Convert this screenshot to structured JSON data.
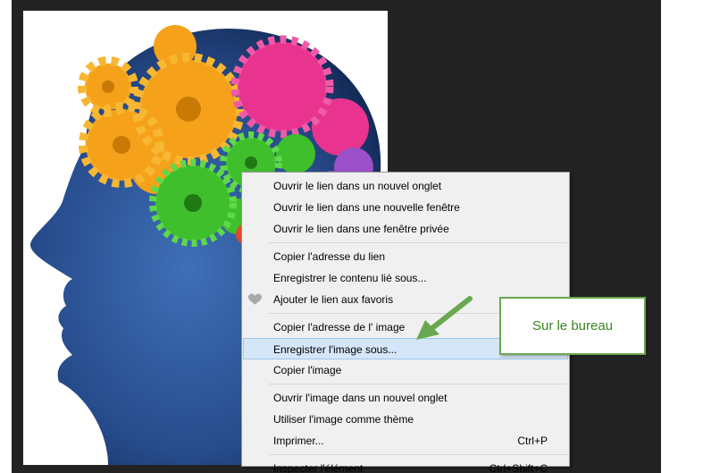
{
  "context_menu": {
    "groups": [
      [
        {
          "label": "Ouvrir le lien dans un nouvel onglet",
          "shortcut": ""
        },
        {
          "label": "Ouvrir le lien dans une nouvelle fenêtre",
          "shortcut": ""
        },
        {
          "label": "Ouvrir le lien dans une fenêtre privée",
          "shortcut": ""
        }
      ],
      [
        {
          "label": "Copier l'adresse du lien",
          "shortcut": ""
        },
        {
          "label": "Enregistrer le contenu lié sous...",
          "shortcut": ""
        },
        {
          "label": "Ajouter le lien aux favoris",
          "shortcut": "",
          "icon": "heart-icon"
        }
      ],
      [
        {
          "label": "Copier l'adresse de l' image",
          "shortcut": ""
        },
        {
          "label": "Enregistrer l'image sous...",
          "shortcut": "",
          "highlighted": true
        },
        {
          "label": "Copier l'image",
          "shortcut": ""
        }
      ],
      [
        {
          "label": "Ouvrir l'image dans un nouvel onglet",
          "shortcut": ""
        },
        {
          "label": "Utiliser l'image comme thème",
          "shortcut": ""
        },
        {
          "label": "Imprimer...",
          "shortcut": "Ctrl+P"
        }
      ],
      [
        {
          "label": "Inspecter l'élément",
          "shortcut": "Ctrl+Shift+C"
        }
      ]
    ]
  },
  "callout": {
    "text": "Sur le bureau",
    "border_color": "#6aa84f",
    "text_color": "#37861f"
  },
  "image": {
    "subject": "head-with-gears-illustration"
  },
  "colors": {
    "menu_bg": "#f0f0f0",
    "highlight_bg": "#d4e6f7",
    "arrow": "#6aa84f",
    "backdrop": "#232323"
  }
}
